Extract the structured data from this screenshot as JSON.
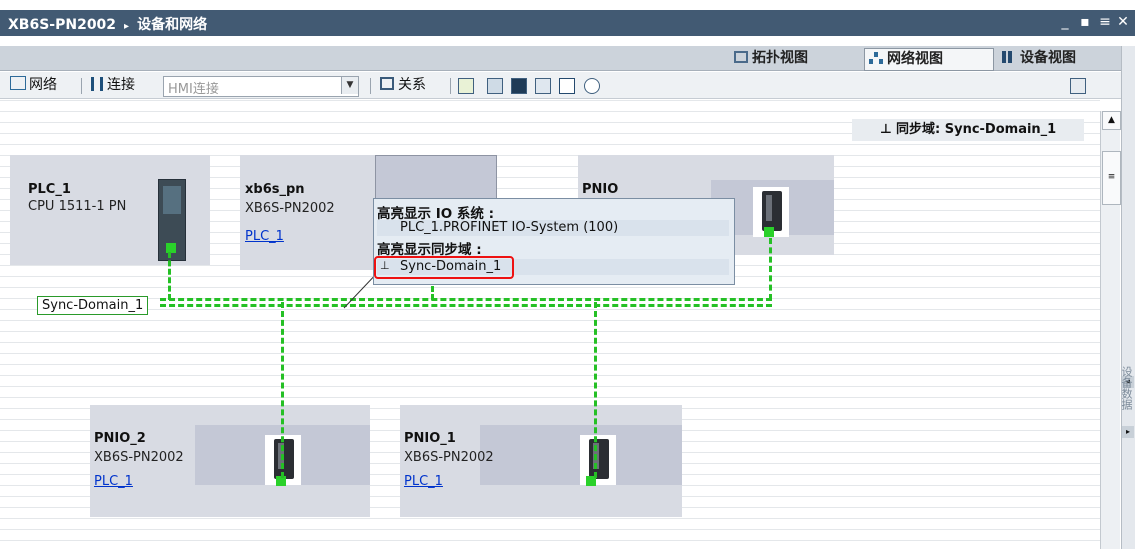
{
  "titlebar": {
    "project": "XB6S-PN2002",
    "separator": "▸",
    "section": "设备和网络",
    "controls": [
      "_",
      "▪",
      "≡",
      "✕"
    ]
  },
  "views": [
    {
      "label": "拓扑视图",
      "active": false
    },
    {
      "label": "网络视图",
      "active": true
    },
    {
      "label": "设备视图",
      "active": false
    }
  ],
  "toolbar": {
    "network_label": "网络",
    "connections_label": "连接",
    "hmi_connection_placeholder": "HMI连接",
    "relations_label": "关系"
  },
  "sync_domain_header": {
    "label": "同步域:",
    "value": "Sync-Domain_1"
  },
  "devices": [
    {
      "name": "PLC_1",
      "type": "CPU 1511-1 PN",
      "link": ""
    },
    {
      "name": "xb6s_pn",
      "type": "XB6S-PN2002",
      "link": "PLC_1"
    },
    {
      "name": "PNIO",
      "type": "",
      "link": ""
    },
    {
      "name": "PNIO_2",
      "type": "XB6S-PN2002",
      "link": "PLC_1"
    },
    {
      "name": "PNIO_1",
      "type": "XB6S-PN2002",
      "link": "PLC_1"
    }
  ],
  "sync_domain_label": "Sync-Domain_1",
  "tooltip": {
    "io_system_heading": "高亮显示 IO 系统 :",
    "io_system_value": "PLC_1.PROFINET IO-System (100)",
    "sync_domain_heading": "高亮显示同步域 :",
    "sync_domain_value": "Sync-Domain_1"
  },
  "side_panel_label": "设备数据",
  "colors": {
    "titlebar": "#425a73",
    "bus": "#25c025",
    "highlight": "#e11111",
    "device_box": "#d8dbe3"
  }
}
